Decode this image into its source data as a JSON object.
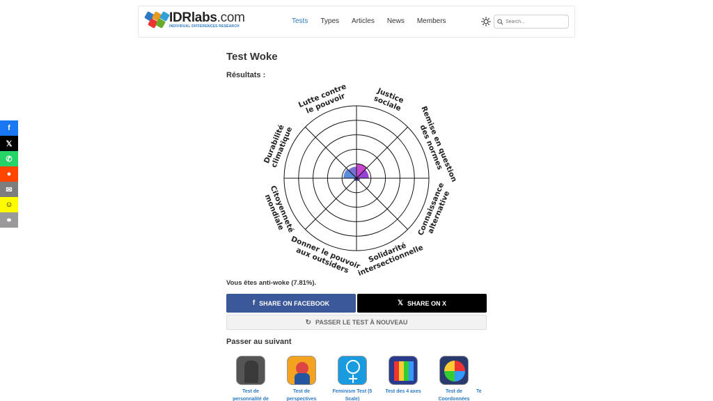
{
  "header": {
    "logo_main": "IDRlabs",
    "logo_dotcom": ".com",
    "logo_sub": "INDIVIDUAL DIFFERENCES RESEARCH",
    "nav": [
      "Tests",
      "Types",
      "Articles",
      "News",
      "Members"
    ],
    "active_nav": "Tests",
    "search_placeholder": "Search..."
  },
  "social": [
    {
      "name": "facebook",
      "glyph": "f",
      "color": "#1877f2"
    },
    {
      "name": "x",
      "glyph": "𝕏",
      "color": "#000000"
    },
    {
      "name": "whatsapp",
      "glyph": "✆",
      "color": "#25d366"
    },
    {
      "name": "reddit",
      "glyph": "●",
      "color": "#ff4500"
    },
    {
      "name": "email",
      "glyph": "✉",
      "color": "#7d7d7d"
    },
    {
      "name": "snapchat",
      "glyph": "☺",
      "color": "#fffc00"
    },
    {
      "name": "copy-link",
      "glyph": "⚭",
      "color": "#9a9a9a"
    }
  ],
  "page": {
    "title": "Test Woke",
    "results_label": "Résultats :",
    "verdict": "Vous êtes anti-woke (7.81%).",
    "share_facebook": "SHARE ON FACEBOOK",
    "share_x": "SHARE ON X",
    "retry": "PASSER LE TEST À NOUVEAU",
    "next_label": "Passer au suivant"
  },
  "chart_data": {
    "type": "radar",
    "rings": 5,
    "categories": [
      {
        "line1": "Justice",
        "line2": "sociale"
      },
      {
        "line1": "Remise en question",
        "line2": "des normes"
      },
      {
        "line1": "Connaissance",
        "line2": "alternative"
      },
      {
        "line1": "Solidarité",
        "line2": "intersectionnelle"
      },
      {
        "line1": "Donner le pouvoir",
        "line2": "aux outsiders"
      },
      {
        "line1": "Citoyenneté",
        "line2": "mondiale"
      },
      {
        "line1": "Durabilité",
        "line2": "climatique"
      },
      {
        "line1": "Lutte contre",
        "line2": "le pouvoir"
      }
    ],
    "values": [
      0.2,
      0.17,
      0.05,
      0.04,
      0.04,
      0.04,
      0.18,
      0.16
    ],
    "colors": [
      "#c032c8",
      "#8b2fd0",
      "#7a3fd0",
      "#6a4fd0",
      "#5a5fd0",
      "#4a70d0",
      "#4a80d8",
      "#6a5fd0"
    ]
  },
  "next_tests": [
    {
      "name_line1": "Test de",
      "name_line2": "personnalité de",
      "icon": "soldier-icon",
      "color": "#555555"
    },
    {
      "name_line1": "Test de",
      "name_line2": "perspectives",
      "icon": "riveter-icon",
      "color": "#f4a321"
    },
    {
      "name_line1": "Feminism Test (5",
      "name_line2": "Scale)",
      "icon": "venus-icon",
      "color": "#1a9be0"
    },
    {
      "name_line1": "Test des 4 axes",
      "name_line2": "",
      "icon": "grid-icon",
      "color": "#2a3a8c"
    },
    {
      "name_line1": "Test de",
      "name_line2": "Coordonnées",
      "icon": "target-icon",
      "color": "#2a3a6c"
    },
    {
      "name_line1": "Te",
      "name_line2": "",
      "icon": "partial-icon",
      "color": "#cccccc"
    }
  ]
}
